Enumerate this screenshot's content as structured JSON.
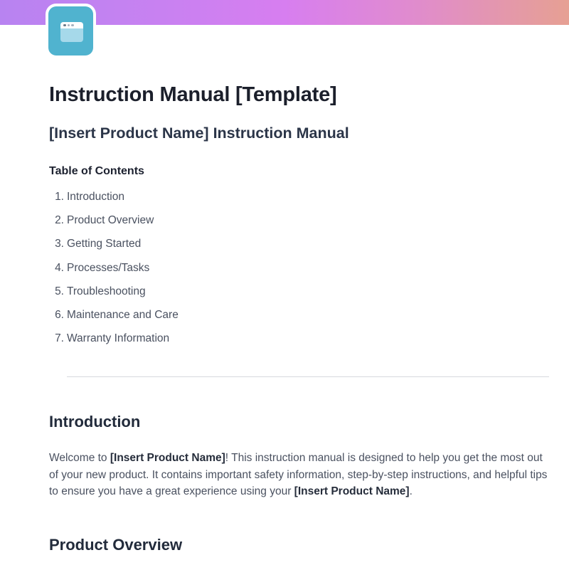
{
  "banner": {
    "gradient_colors": [
      "#b883f1",
      "#d77ef0",
      "#e6a093"
    ]
  },
  "page_icon": {
    "name": "browser-window-icon",
    "color": "#50b3cf"
  },
  "document": {
    "title": "Instruction Manual [Template]",
    "subtitle": "[Insert Product Name] Instruction Manual",
    "toc_heading": "Table of Contents",
    "toc_items": [
      {
        "num": "1.",
        "label": "Introduction"
      },
      {
        "num": "2.",
        "label": "Product Overview"
      },
      {
        "num": "3.",
        "label": "Getting Started"
      },
      {
        "num": "4.",
        "label": "Processes/Tasks"
      },
      {
        "num": "5.",
        "label": "Troubleshooting"
      },
      {
        "num": "6.",
        "label": "Maintenance and Care"
      },
      {
        "num": "7.",
        "label": "Warranty Information"
      }
    ],
    "introduction": {
      "heading": "Introduction",
      "p_before": "Welcome to ",
      "p_bold1": "[Insert Product Name]",
      "p_middle": "! This instruction manual is designed to help you get the most out of your new product. It contains important safety information, step-by-step instructions, and helpful tips to ensure you have a great experience using your ",
      "p_bold2": "[Insert Product Name]",
      "p_after": "."
    },
    "product_overview": {
      "heading": "Product Overview"
    }
  }
}
